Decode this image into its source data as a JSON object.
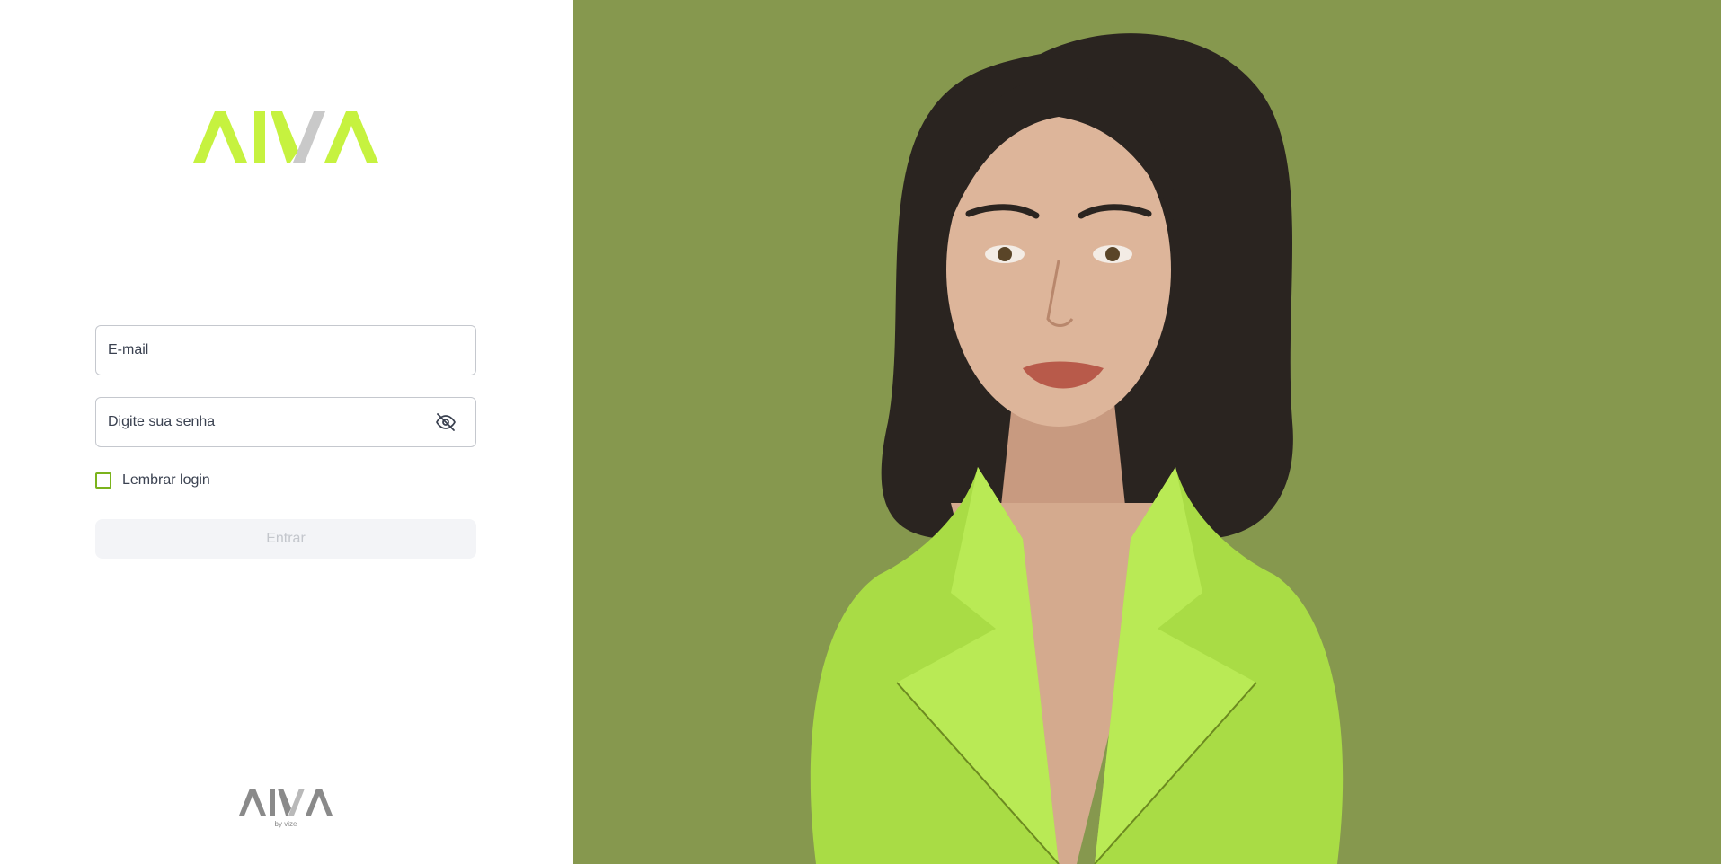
{
  "brand": {
    "logo_text": "AIVA",
    "footer_logo_text": "AIVA",
    "footer_tagline": "by vize",
    "accent_color": "#c6f23f",
    "secondary_color": "#c9c9c9"
  },
  "form": {
    "email_placeholder": "E-mail",
    "password_placeholder": "Digite sua senha",
    "password_toggle_icon": "eye-off-icon",
    "remember_label": "Lembrar login",
    "remember_checked": false,
    "submit_label": "Entrar",
    "submit_enabled": false
  },
  "hero": {
    "background_color": "#86984e",
    "image_subject": "avatar-illustration"
  }
}
